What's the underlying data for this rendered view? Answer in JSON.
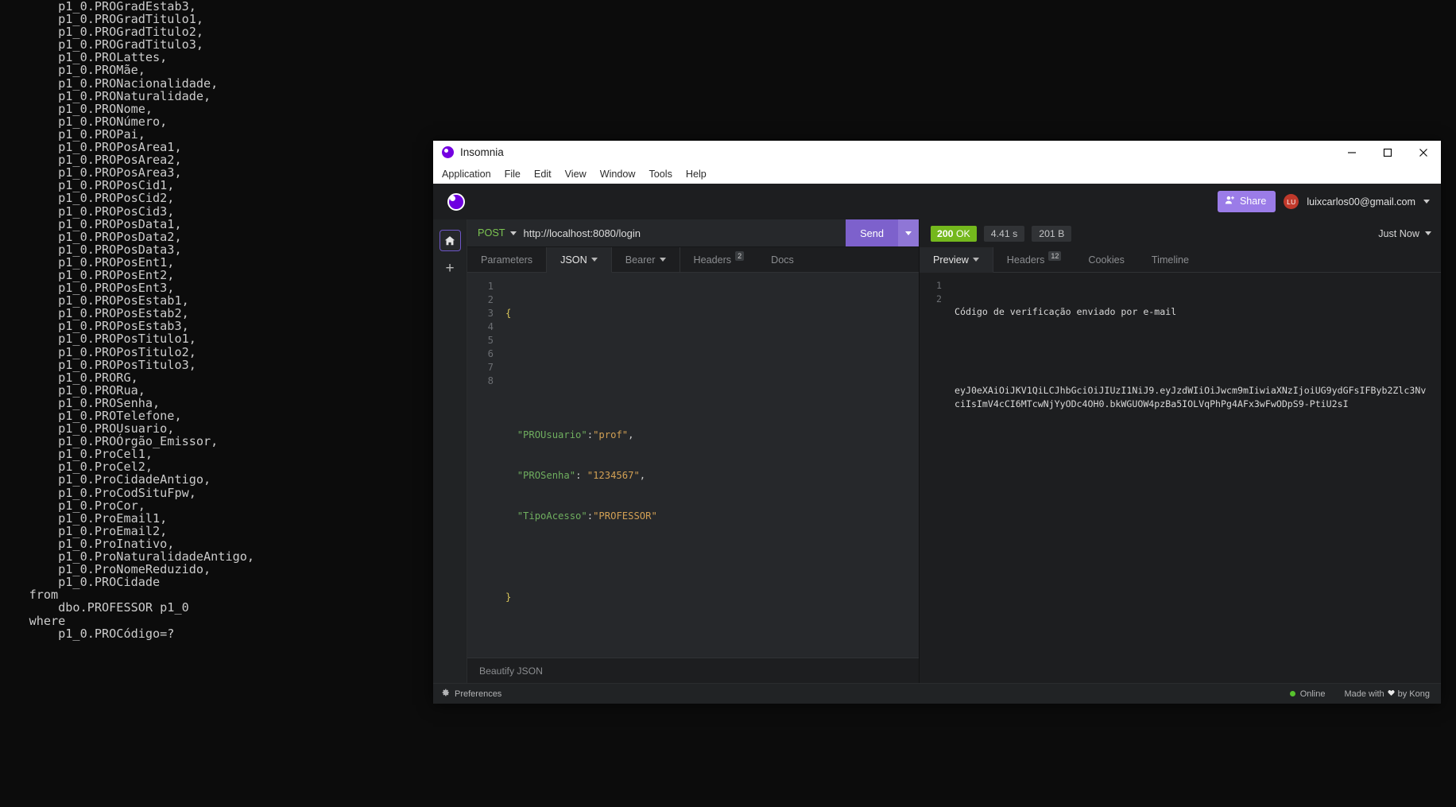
{
  "terminal": {
    "lines": [
      "        p1_0.PROGradEstab3,",
      "        p1_0.PROGradTitulo1,",
      "        p1_0.PROGradTitulo2,",
      "        p1_0.PROGradTitulo3,",
      "        p1_0.PROLattes,",
      "        p1_0.PROMãe,",
      "        p1_0.PRONacionalidade,",
      "        p1_0.PRONaturalidade,",
      "        p1_0.PRONome,",
      "        p1_0.PRONúmero,",
      "        p1_0.PROPai,",
      "        p1_0.PROPosArea1,",
      "        p1_0.PROPosArea2,",
      "        p1_0.PROPosArea3,",
      "        p1_0.PROPosCid1,",
      "        p1_0.PROPosCid2,",
      "        p1_0.PROPosCid3,",
      "        p1_0.PROPosData1,",
      "        p1_0.PROPosData2,",
      "        p1_0.PROPosData3,",
      "        p1_0.PROPosEnt1,",
      "        p1_0.PROPosEnt2,",
      "        p1_0.PROPosEnt3,",
      "        p1_0.PROPosEstab1,",
      "        p1_0.PROPosEstab2,",
      "        p1_0.PROPosEstab3,",
      "        p1_0.PROPosTitulo1,",
      "        p1_0.PROPosTitulo2,",
      "        p1_0.PROPosTitulo3,",
      "        p1_0.PRORG,",
      "        p1_0.PRORua,",
      "        p1_0.PROSenha,",
      "        p1_0.PROTelefone,",
      "        p1_0.PROUsuario,",
      "        p1_0.PROÓrgão_Emissor,",
      "        p1_0.ProCel1,",
      "        p1_0.ProCel2,",
      "        p1_0.ProCidadeAntigo,",
      "        p1_0.ProCodSituFpw,",
      "        p1_0.ProCor,",
      "        p1_0.ProEmail1,",
      "        p1_0.ProEmail2,",
      "        p1_0.ProInativo,",
      "        p1_0.ProNaturalidadeAntigo,",
      "        p1_0.ProNomeReduzido,",
      "        p1_0.PROCidade",
      "    from",
      "        dbo.PROFESSOR p1_0",
      "    where",
      "        p1_0.PROCódigo=?"
    ]
  },
  "window": {
    "title": "Insomnia",
    "menu": [
      "Application",
      "File",
      "Edit",
      "View",
      "Window",
      "Tools",
      "Help"
    ],
    "controls": {
      "minimize": "minimize-icon",
      "maximize": "maximize-icon",
      "close": "close-icon"
    }
  },
  "header": {
    "logo_icon": "insomnia-logo-icon",
    "share_label": "Share",
    "share_icon": "user-plus-icon",
    "avatar_initials": "LU",
    "account_email": "luixcarlos00@gmail.com",
    "account_caret_icon": "chevron-down-icon"
  },
  "rail": {
    "home_icon": "home-icon",
    "plus_icon": "plus-icon"
  },
  "request": {
    "method": "POST",
    "method_caret_icon": "chevron-down-icon",
    "url": "http://localhost:8080/login",
    "send_label": "Send",
    "send_caret_icon": "chevron-down-icon",
    "tabs": [
      {
        "label": "Parameters",
        "active": false,
        "caret": false,
        "badge": ""
      },
      {
        "label": "JSON",
        "active": true,
        "caret": true,
        "badge": ""
      },
      {
        "label": "Bearer",
        "active": false,
        "caret": true,
        "badge": ""
      },
      {
        "label": "Headers",
        "active": false,
        "caret": false,
        "badge": "2"
      },
      {
        "label": "Docs",
        "active": false,
        "caret": false,
        "badge": ""
      }
    ],
    "editor": {
      "line_numbers": [
        "1",
        "2",
        "3",
        "4",
        "5",
        "6",
        "7",
        "8"
      ],
      "body_lines": [
        "{",
        "",
        "",
        "  \"PROUsuario\":\"prof\",",
        "  \"PROSenha\": \"1234567\",",
        "  \"TipoAcesso\":\"PROFESSOR\"",
        "",
        "}"
      ],
      "json": {
        "PROUsuario": "prof",
        "PROSenha": "1234567",
        "TipoAcesso": "PROFESSOR"
      }
    },
    "beautify_label": "Beautify JSON"
  },
  "response": {
    "status_code": "200",
    "status_text": "OK",
    "time": "4.41 s",
    "size": "201 B",
    "timestamp_label": "Just Now",
    "timestamp_caret_icon": "chevron-down-icon",
    "tabs": [
      {
        "label": "Preview",
        "active": true,
        "caret": true,
        "badge": ""
      },
      {
        "label": "Headers",
        "active": false,
        "caret": false,
        "badge": "12"
      },
      {
        "label": "Cookies",
        "active": false,
        "caret": false,
        "badge": ""
      },
      {
        "label": "Timeline",
        "active": false,
        "caret": false,
        "badge": ""
      }
    ],
    "line_numbers": [
      "1",
      "2"
    ],
    "message": "Código de verificação enviado por e-mail",
    "token": "eyJ0eXAiOiJKV1QiLCJhbGciOiJIUzI1NiJ9.eyJzdWIiOiJwcm9mIiwiaXNzIjoiUG9ydGFsIFByb2Zlc3NvciIsImV4cCI6MTcwNjYyODc4OH0.bkWGUOW4pzBa5IOLVqPhPg4AFx3wFwODpS9-PtiU2sI"
  },
  "footer": {
    "preferences_label": "Preferences",
    "preferences_icon": "gear-icon",
    "online_label": "Online",
    "made_with_prefix": "Made with",
    "made_with_suffix": "by Kong",
    "heart_icon": "heart-icon"
  },
  "colors": {
    "accent": "#7d61cc",
    "brand_purple": "#6e00e0",
    "status_ok": "#74b81d",
    "method_post": "#7cc451",
    "json_key": "#6fae5f",
    "json_value": "#d2a054",
    "avatar": "#c0392b",
    "online": "#57c22d"
  }
}
